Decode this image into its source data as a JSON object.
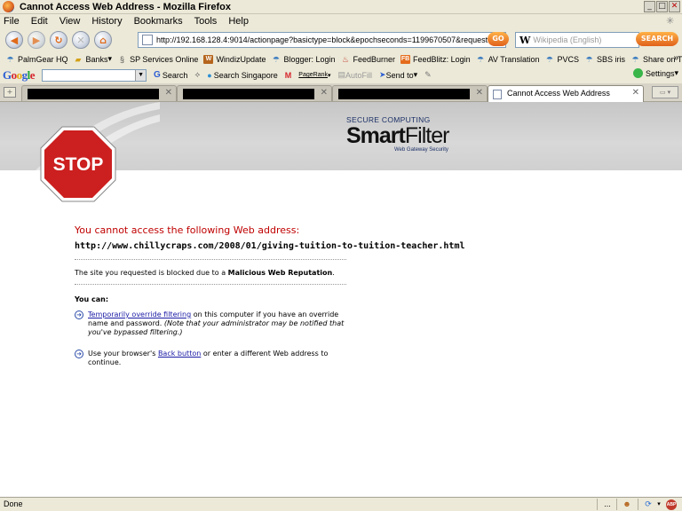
{
  "window": {
    "title": "Cannot Access Web Address - Mozilla Firefox"
  },
  "menu": [
    "File",
    "Edit",
    "View",
    "History",
    "Bookmarks",
    "Tools",
    "Help"
  ],
  "navigation": {
    "url": "http://192.168.128.4:9014/actionpage?basictype=block&epochseconds=1199670507&requestedurl=http",
    "go_label": "GO",
    "search_placeholder": "Wikipedia (English)",
    "search_engine_glyph": "W",
    "search_button": "SEARCH"
  },
  "bookmarks": [
    {
      "label": "PalmGear HQ",
      "icon": "bookmark-icon"
    },
    {
      "label": "Banks",
      "icon": "folder-icon",
      "dropdown": "▾"
    },
    {
      "label": "SP Services Online",
      "icon": "sp-icon"
    },
    {
      "label": "WindizUpdate",
      "icon": "w-box-icon"
    },
    {
      "label": "Blogger: Login",
      "icon": "bookmark-icon"
    },
    {
      "label": "FeedBurner",
      "icon": "flame-icon"
    },
    {
      "label": "FeedBlitz: Login",
      "icon": "fb-box-icon"
    },
    {
      "label": "AV Translation",
      "icon": "bookmark-icon"
    },
    {
      "label": "PVCS",
      "icon": "bookmark-icon"
    },
    {
      "label": "SBS iris",
      "icon": "bookmark-icon"
    },
    {
      "label": "Share on Tumblr",
      "icon": "bookmark-icon"
    }
  ],
  "google_toolbar": {
    "logo": "Google",
    "search_label": "Search",
    "search_singapore": "Search Singapore",
    "pagerank": "PageRank",
    "autofill": "AutoFill",
    "send_to": "Send to",
    "settings": "Settings"
  },
  "tabs": {
    "active_label": "Cannot Access Web Address"
  },
  "brand": {
    "tagline_top": "SECURE COMPUTING",
    "name_a": "Smart",
    "name_b": "Filter",
    "tagline_bottom": "Web Gateway Security",
    "stop_text": "STOP"
  },
  "block_page": {
    "heading": "You cannot access the following Web address:",
    "blocked_url": "http://www.chillycraps.com/2008/01/giving-tuition-to-tuition-teacher.html",
    "reason_prefix": "The site you requested is blocked due to a ",
    "reason_bold": "Malicious Web Reputation",
    "reason_suffix": ".",
    "you_can": "You can:",
    "option1_link": "Temporarily override filtering",
    "option1_text": " on this computer if you have an override name and password. ",
    "option1_note": "(Note that your administrator may be notified that you've bypassed filtering.)",
    "option2_prefix": "Use your browser's ",
    "option2_link": "Back button",
    "option2_suffix": " or enter a different Web address to continue."
  },
  "status": {
    "text": "Done",
    "ellipsis": "...",
    "abp": "ABP"
  },
  "colors": {
    "heading_red": "#c00000",
    "link_blue": "#1a1aa6",
    "stop_red": "#cc1f1f"
  }
}
